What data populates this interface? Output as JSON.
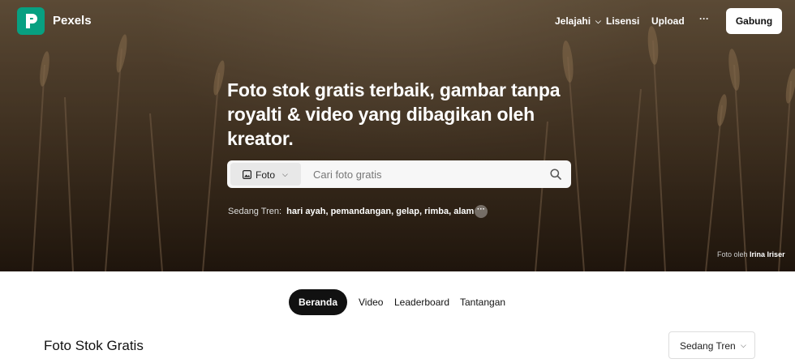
{
  "header": {
    "brand": "Pexels",
    "nav": [
      {
        "label": "Jelajahi",
        "has_dropdown": true
      },
      {
        "label": "Lisensi"
      },
      {
        "label": "Upload"
      },
      {
        "label": "···"
      }
    ],
    "join_label": "Gabung"
  },
  "hero": {
    "headline": "Foto stok gratis terbaik, gambar tanpa royalti & video yang dibagikan oleh kreator.",
    "search": {
      "type_label": "Foto",
      "placeholder": "Cari foto gratis"
    },
    "trending": {
      "label": "Sedang Tren:",
      "tags": [
        "hari ayah",
        "pemandangan",
        "gelap",
        "rimba",
        "alam"
      ]
    },
    "credit": {
      "prefix": "Foto oleh",
      "author": "Irina Iriser"
    }
  },
  "tabs": [
    {
      "label": "Beranda",
      "active": true
    },
    {
      "label": "Video"
    },
    {
      "label": "Leaderboard"
    },
    {
      "label": "Tantangan"
    }
  ],
  "section": {
    "title": "Foto Stok Gratis",
    "sort_label": "Sedang Tren"
  },
  "colors": {
    "brand": "#07a081",
    "tab_active": "#111111"
  },
  "icons": [
    "pexels-logo-icon",
    "chevron-down-icon",
    "image-icon",
    "search-icon",
    "more-dots-icon"
  ]
}
